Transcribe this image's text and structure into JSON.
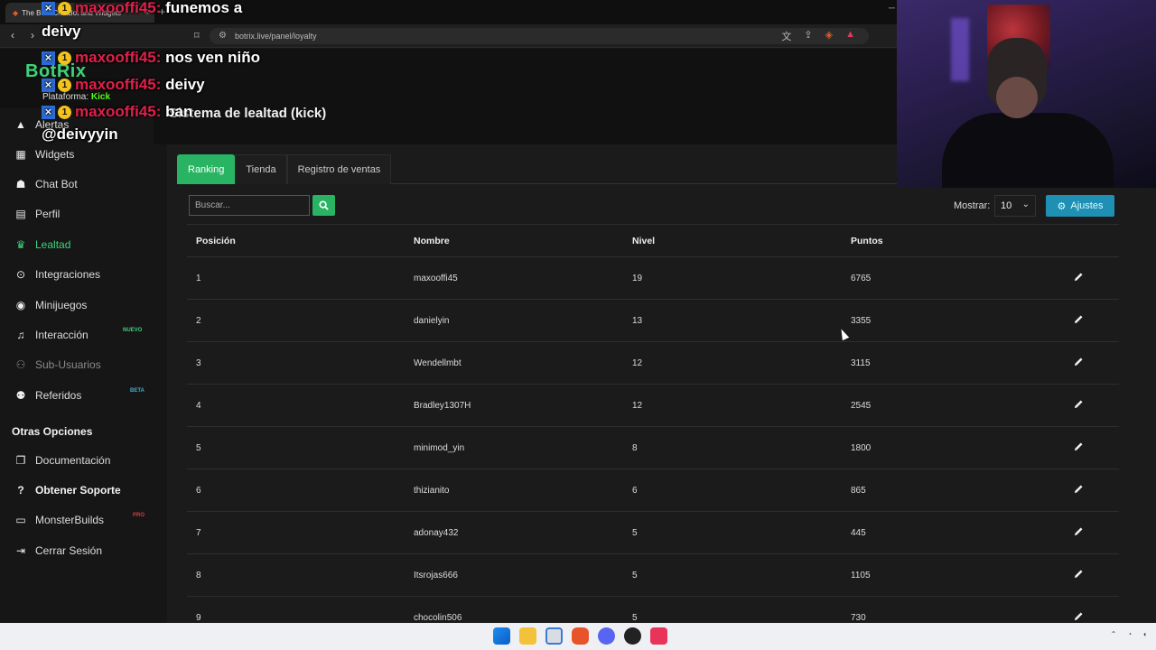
{
  "browser": {
    "tab_title": "The Best ChatBot and Widgets",
    "url": "botrix.live/panel/loyalty"
  },
  "app": {
    "brand": "BotRix",
    "platform_label": "Plataforma:",
    "platform_value": "Kick",
    "page_title": "Sistema de lealtad (kick)"
  },
  "sidebar": {
    "items": [
      {
        "label": "Alertas",
        "icon": "warning-icon"
      },
      {
        "label": "Widgets",
        "icon": "th-icon"
      },
      {
        "label": "Chat Bot",
        "icon": "robot-icon"
      },
      {
        "label": "Perfil",
        "icon": "id-card-icon"
      },
      {
        "label": "Lealtad",
        "icon": "trophy-icon"
      },
      {
        "label": "Integraciones",
        "icon": "plug-icon"
      },
      {
        "label": "Minijuegos",
        "icon": "gamepad-icon"
      },
      {
        "label": "Interacción",
        "icon": "music-icon"
      },
      {
        "label": "Sub-Usuarios",
        "icon": "users-cog-icon"
      },
      {
        "label": "Referidos",
        "icon": "users-icon"
      }
    ],
    "badges": {
      "interaccion": "NUEVO",
      "referidos": "BETA",
      "monsterbuilds": "PRO"
    },
    "other_heading": "Otras Opciones",
    "other_items": [
      {
        "label": "Documentación",
        "icon": "book-icon"
      },
      {
        "label": "Obtener Soporte",
        "icon": "question-icon"
      },
      {
        "label": "MonsterBuilds",
        "icon": "desktop-icon"
      },
      {
        "label": "Cerrar Sesión",
        "icon": "sign-out-icon"
      }
    ]
  },
  "tabs": [
    "Ranking",
    "Tienda",
    "Registro de ventas"
  ],
  "controls": {
    "search_placeholder": "Buscar...",
    "show_label": "Mostrar:",
    "show_value": "10",
    "settings_label": "Ajustes"
  },
  "table": {
    "headers": [
      "Posición",
      "Nombre",
      "Nivel",
      "Puntos"
    ],
    "rows": [
      [
        "1",
        "maxooffi45",
        "19",
        "6765"
      ],
      [
        "2",
        "danielyin",
        "13",
        "3355"
      ],
      [
        "3",
        "Wendellmbt",
        "12",
        "3115"
      ],
      [
        "4",
        "Bradley1307H",
        "12",
        "2545"
      ],
      [
        "5",
        "minimod_yin",
        "8",
        "1800"
      ],
      [
        "6",
        "thizianito",
        "6",
        "865"
      ],
      [
        "7",
        "adonay432",
        "5",
        "445"
      ],
      [
        "8",
        "Itsrojas666",
        "5",
        "1105"
      ],
      [
        "9",
        "chocolin506",
        "5",
        "730"
      ]
    ]
  },
  "chat": {
    "messages": [
      {
        "user": "maxooffi45:",
        "text": "funemos a"
      },
      {
        "user": "",
        "text": "deivy"
      },
      {
        "user": "maxooffi45:",
        "text": "nos ven niño"
      },
      {
        "user": "maxooffi45:",
        "text": "deivy"
      },
      {
        "user": "maxooffi45:",
        "text": "ban"
      },
      {
        "user": "",
        "text": "@deivyyin"
      }
    ],
    "level_badge": "1"
  },
  "colors": {
    "accent_green": "#28b463",
    "accent_blue": "#1f8fb4",
    "chat_user": "#e0204a"
  }
}
